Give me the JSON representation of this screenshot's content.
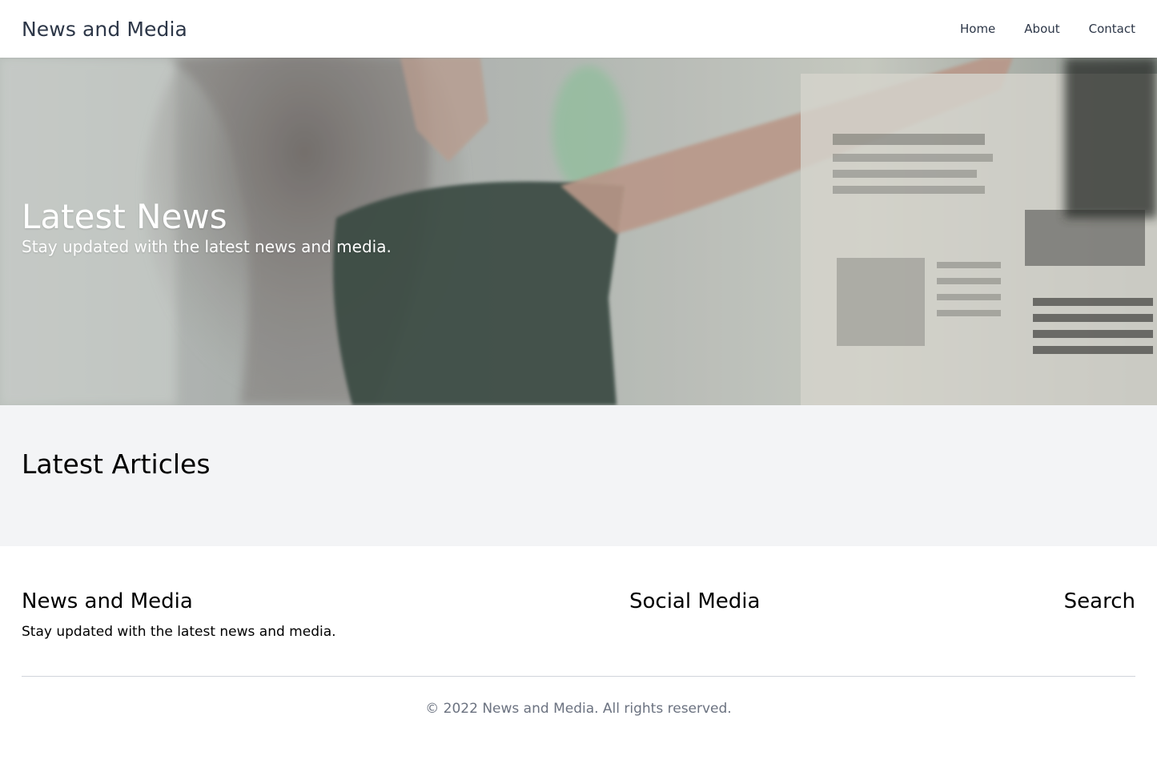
{
  "header": {
    "brand": "News and Media",
    "nav": [
      {
        "label": "Home"
      },
      {
        "label": "About"
      },
      {
        "label": "Contact"
      }
    ]
  },
  "hero": {
    "title": "Latest News",
    "subtitle": "Stay updated with the latest news and media."
  },
  "articles": {
    "heading": "Latest Articles"
  },
  "footer": {
    "brand_heading": "News and Media",
    "brand_text": "Stay updated with the latest news and media.",
    "social_heading": "Social Media",
    "search_heading": "Search",
    "copyright": "© 2022 News and Media. All rights reserved."
  },
  "colors": {
    "header_bg": "#ffffff",
    "text_dark": "#2d3748",
    "articles_bg": "#f3f4f6",
    "copyright_text": "#6b7280"
  }
}
